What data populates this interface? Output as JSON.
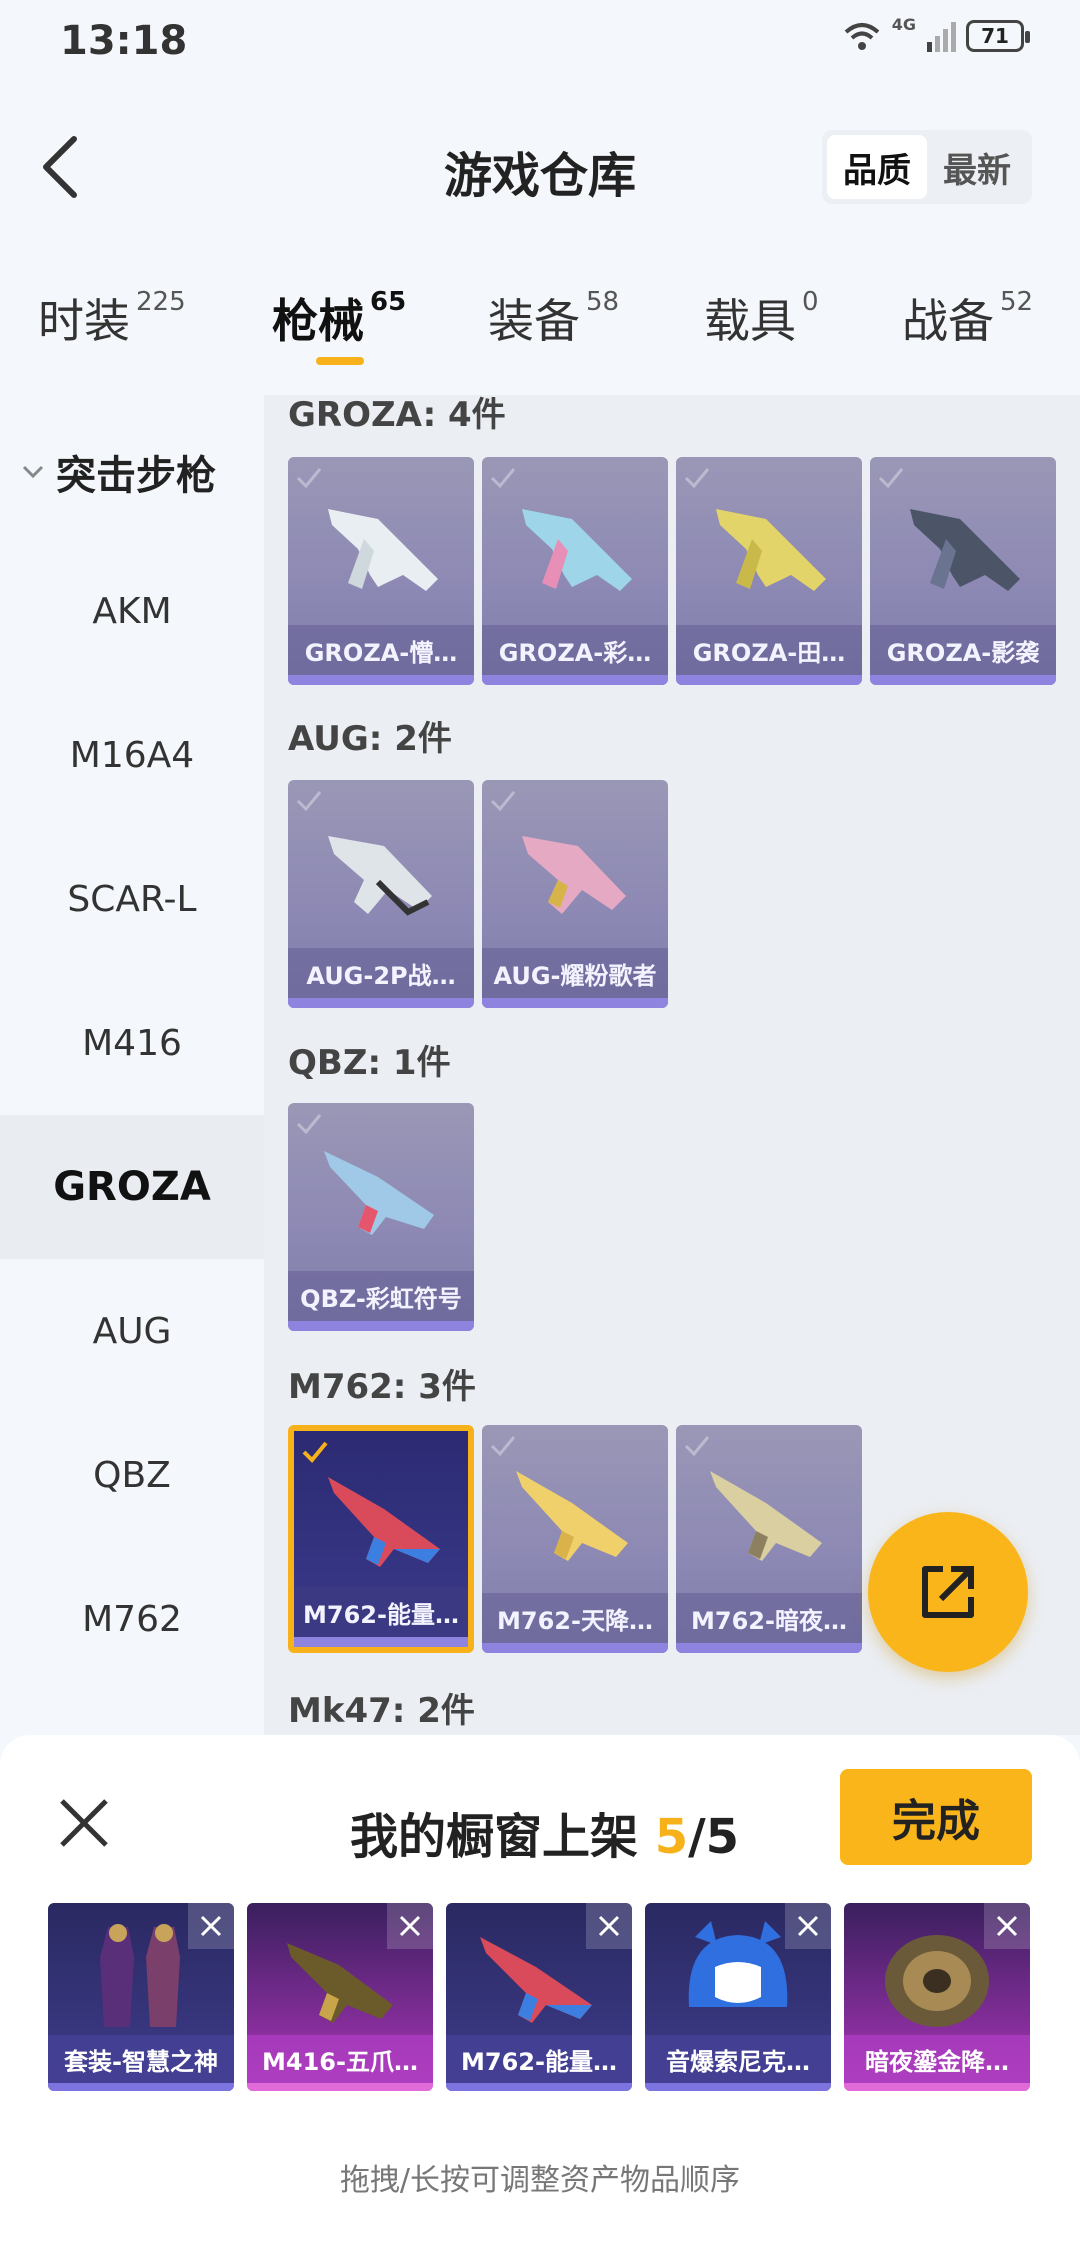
{
  "status": {
    "time": "13:18",
    "network": "4G",
    "battery": "71"
  },
  "header": {
    "title": "游戏仓库",
    "sort_quality": "品质",
    "sort_newest": "最新"
  },
  "tabs": [
    {
      "label": "时装",
      "count": "225"
    },
    {
      "label": "枪械",
      "count": "65"
    },
    {
      "label": "装备",
      "count": "58"
    },
    {
      "label": "载具",
      "count": "0"
    },
    {
      "label": "战备",
      "count": "52"
    }
  ],
  "sidebar": {
    "group": "突击步枪",
    "items": [
      "AKM",
      "M16A4",
      "SCAR-L",
      "M416",
      "GROZA",
      "AUG",
      "QBZ",
      "M762"
    ],
    "active": "GROZA"
  },
  "groups": [
    {
      "title": "GROZA: 4件",
      "items": [
        "GROZA-懵…",
        "GROZA-彩…",
        "GROZA-田…",
        "GROZA-影袭"
      ]
    },
    {
      "title": "AUG: 2件",
      "items": [
        "AUG-2P战…",
        "AUG-耀粉歌者"
      ]
    },
    {
      "title": "QBZ: 1件",
      "items": [
        "QBZ-彩虹符号"
      ]
    },
    {
      "title": "M762: 3件",
      "items": [
        "M762-能量…",
        "M762-天降…",
        "M762-暗夜…"
      ]
    },
    {
      "title": "Mk47: 2件",
      "items": []
    }
  ],
  "sheet": {
    "title": "我的橱窗上架",
    "count_current": "5",
    "count_sep_total": "/5",
    "done_label": "完成",
    "items": [
      "套装-智慧之神",
      "M416-五爪…",
      "M762-能量…",
      "音爆索尼克…",
      "暗夜鎏金降…"
    ],
    "hint": "拖拽/长按可调整资产物品顺序"
  },
  "colors": {
    "accent": "#f9b51a",
    "rare_purple": "#8c88b4",
    "epic_pink": "#c34dc6"
  }
}
